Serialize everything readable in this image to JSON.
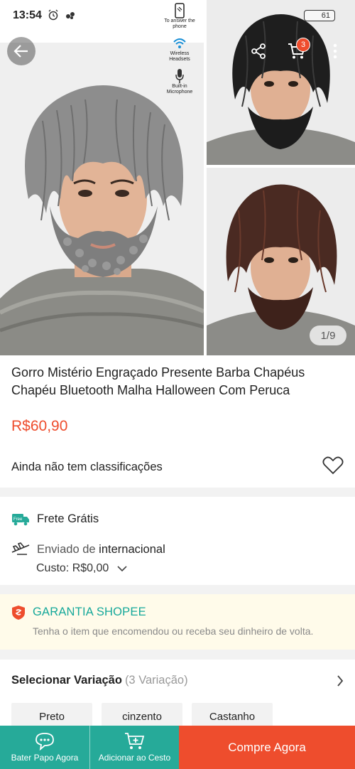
{
  "status_bar": {
    "time": "13:54",
    "battery": "61",
    "icons": [
      "alarm-icon",
      "notification-icon"
    ]
  },
  "gallery": {
    "feature_labels": [
      "To answer the phone",
      "Wireless Headsets",
      "Built-in Microphone"
    ],
    "cart_count": "3",
    "image_counter": "1/9",
    "images": [
      "gray-wig-beard-hat-photo",
      "black-wig-beard-hat-photo",
      "brown-wig-beard-hat-photo"
    ]
  },
  "product": {
    "title": "Gorro Mistério Engraçado Presente Barba Chapéus Chapéu Bluetooth Malha Halloween Com Peruca",
    "price": "R$60,90",
    "rating_text": "Ainda não tem classificações"
  },
  "shipping": {
    "free_shipping": "Frete Grátis",
    "free_badge": "Free",
    "sent_from_prefix": "Enviado de",
    "sent_from_location": "internacional",
    "cost": "Custo: R$0,00"
  },
  "guarantee": {
    "title": "GARANTIA SHOPEE",
    "description": "Tenha o item que encomendou ou receba seu dinheiro de volta."
  },
  "variation": {
    "title": "Selecionar Variação",
    "count": "(3 Variação)",
    "options": [
      "Preto",
      "cinzento",
      "Castanho"
    ]
  },
  "bottom_bar": {
    "chat_label": "Bater Papo Agora",
    "cart_label": "Adicionar ao Cesto",
    "buy_label": "Compre Agora"
  },
  "colors": {
    "accent": "#ee4d2d",
    "teal": "#26aa99",
    "guarantee_bg": "#fffbea"
  }
}
